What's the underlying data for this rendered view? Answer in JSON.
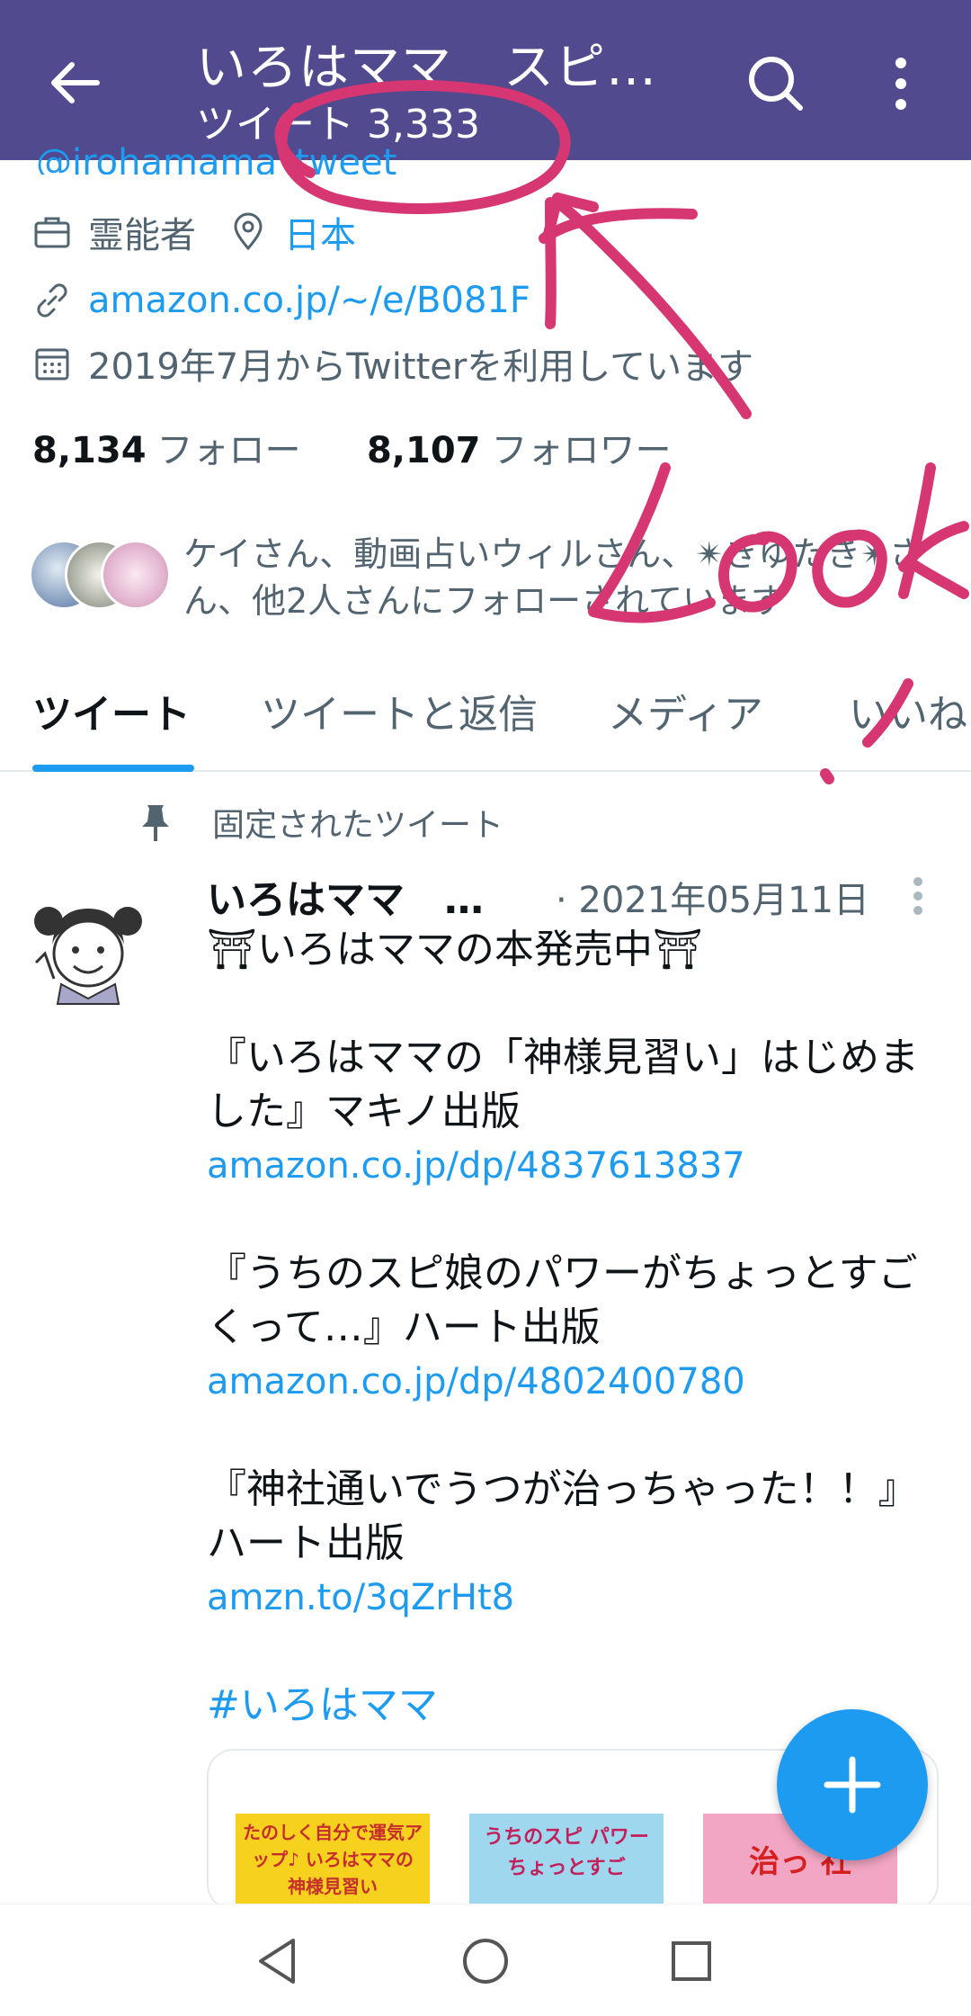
{
  "header": {
    "title": "いろはママ　スピ…",
    "subtitle": "ツイート 3,333"
  },
  "profile": {
    "handle_cut": "@irohamama_tweet",
    "job": "霊能者",
    "location": "日本",
    "link": "amazon.co.jp/~/e/B081F",
    "joined": "2019年7月からTwitterを利用しています",
    "following_count": "8,134",
    "following_label": "フォロー",
    "followers_count": "8,107",
    "followers_label": "フォロワー",
    "followed_by": "ケイさん、動画占いウィルさん、✴︎きゆたき✴︎さん、他2人さんにフォローされています"
  },
  "tabs": [
    {
      "label": "ツイート"
    },
    {
      "label": "ツイートと返信"
    },
    {
      "label": "メディア"
    },
    {
      "label": "いいね"
    }
  ],
  "tweet": {
    "pinned_label": "固定されたツイート",
    "author": "いろはママ　…",
    "date": "· 2021年05月11日",
    "line1": "⛩いろはママの本発売中⛩",
    "book1": "『いろはママの「神様見習い」はじめました』マキノ出版",
    "link1": "amazon.co.jp/dp/4837613837",
    "book2": "『うちのスピ娘のパワーがちょっとすごくって…』ハート出版",
    "link2": "amazon.co.jp/dp/4802400780",
    "book3": "『神社通いでうつが治っちゃった！！』ハート出版",
    "link3": "amzn.to/3qZrHt8",
    "hashtag": "#いろはママ"
  },
  "card": {
    "book1_text": "たのしく自分で運気アップ♪ いろはママの 神様見習い",
    "book2_text": "うちのスピ パワー ちょっとすご",
    "book3_text": "治っ 社"
  },
  "annotation": {
    "word": "Look",
    "color": "#d63671"
  },
  "colors": {
    "header_bg": "#514a8e",
    "accent": "#1d9bf0"
  }
}
